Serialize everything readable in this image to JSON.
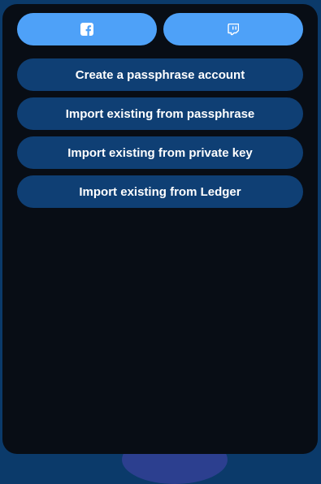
{
  "social": [
    {
      "icon": "facebook-icon"
    },
    {
      "icon": "twitch-icon"
    }
  ],
  "actions": {
    "create_passphrase": "Create a passphrase account",
    "import_passphrase": "Import existing from passphrase",
    "import_private_key": "Import existing from private key",
    "import_ledger": "Import existing from Ledger"
  },
  "colors": {
    "background": "#0b3a6a",
    "panel": "#080d15",
    "social_button": "#4ea1f8",
    "action_button": "#0f3f74",
    "text": "#ffffff"
  }
}
